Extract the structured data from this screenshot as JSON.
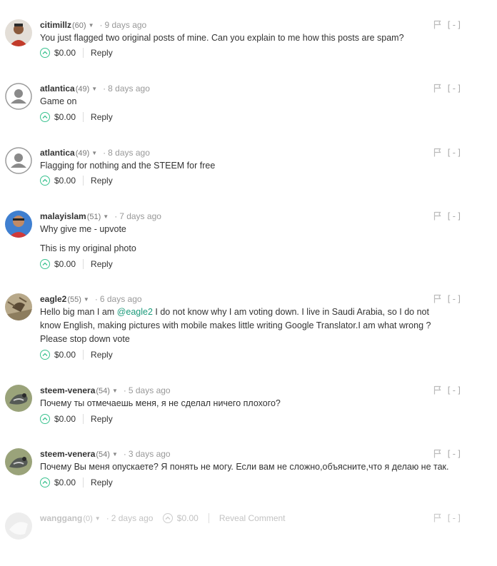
{
  "comments": [
    {
      "author": "citimillz",
      "rep": "(60)",
      "age": "9 days ago",
      "lines": [
        "You just flagged two original posts of mine. Can you explain to me how this posts are spam?"
      ],
      "payout": "$0.00",
      "reply": "Reply",
      "collapse": "[-]"
    },
    {
      "author": "atlantica",
      "rep": "(49)",
      "age": "8 days ago",
      "lines": [
        "Game on"
      ],
      "payout": "$0.00",
      "reply": "Reply",
      "collapse": "[-]"
    },
    {
      "author": "atlantica",
      "rep": "(49)",
      "age": "8 days ago",
      "lines": [
        "Flagging for nothing and the STEEM for free"
      ],
      "payout": "$0.00",
      "reply": "Reply",
      "collapse": "[-]"
    },
    {
      "author": "malayislam",
      "rep": "(51)",
      "age": "7 days ago",
      "lines": [
        "Why give me - upvote",
        "This is my original photo"
      ],
      "payout": "$0.00",
      "reply": "Reply",
      "collapse": "[-]"
    },
    {
      "author": "eagle2",
      "rep": "(55)",
      "age": "6 days ago",
      "body_before": "Hello big man I am ",
      "mention": "@eagle2",
      "body_after": " I do not know why I am voting down. I live in Saudi Arabia, so I do not know English, making pictures with mobile makes little writing Google Translator.I am what wrong ? Please stop down vote",
      "payout": "$0.00",
      "reply": "Reply",
      "collapse": "[-]"
    },
    {
      "author": "steem-venera",
      "rep": "(54)",
      "age": "5 days ago",
      "lines": [
        "Почему ты отмечаешь меня, я не сделал ничего плохого?"
      ],
      "payout": "$0.00",
      "reply": "Reply",
      "collapse": "[-]"
    },
    {
      "author": "steem-venera",
      "rep": "(54)",
      "age": "3 days ago",
      "lines": [
        "Почему Вы меня опускаете? Я понять не могу. Если вам не сложно,объясните,что я делаю не так."
      ],
      "payout": "$0.00",
      "reply": "Reply",
      "collapse": "[-]"
    },
    {
      "author": "wanggang",
      "rep": "(0)",
      "age": "2 days ago",
      "payout": "$0.00",
      "reveal": "Reveal Comment",
      "collapse": "[-]"
    }
  ],
  "colors": {
    "accent": "#3ac28f",
    "mention": "#1a9a7a",
    "muted": "#c3c3c3"
  },
  "icons": [
    "flag-icon",
    "upvote-chevron-icon",
    "caret-down-icon"
  ]
}
